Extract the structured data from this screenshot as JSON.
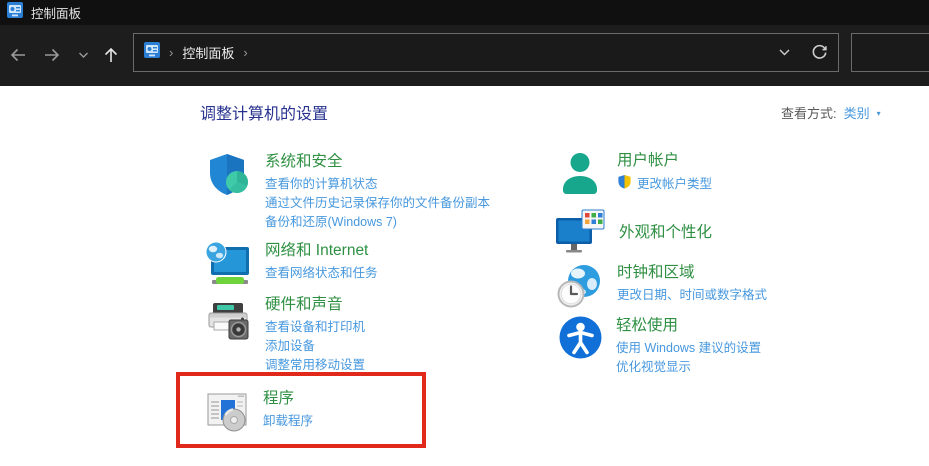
{
  "window": {
    "title": "控制面板"
  },
  "navbar": {
    "breadcrumb_root": "控制面板",
    "breadcrumb_separator": "›"
  },
  "content": {
    "heading": "调整计算机的设置",
    "view_by_label": "查看方式:",
    "view_by_value": "类别",
    "view_by_caret": "▾",
    "categories": [
      {
        "title": "系统和安全",
        "icon": "system-security-shield-icon",
        "links": [
          "查看你的计算机状态",
          "通过文件历史记录保存你的文件备份副本",
          "备份和还原(Windows 7)"
        ]
      },
      {
        "title": "网络和 Internet",
        "icon": "network-monitor-globe-icon",
        "links": [
          "查看网络状态和任务"
        ]
      },
      {
        "title": "硬件和声音",
        "icon": "printer-speaker-icon",
        "links": [
          "查看设备和打印机",
          "添加设备",
          "调整常用移动设置"
        ]
      },
      {
        "title": "程序",
        "icon": "programs-disc-icon",
        "highlighted": true,
        "links": [
          "卸载程序"
        ]
      },
      {
        "title": "用户帐户",
        "icon": "user-accounts-icon",
        "links": [
          "更改帐户类型"
        ]
      },
      {
        "title": "外观和个性化",
        "icon": "appearance-personalization-icon",
        "links": []
      },
      {
        "title": "时钟和区域",
        "icon": "clock-region-icon",
        "links": [
          "更改日期、时间或数字格式"
        ]
      },
      {
        "title": "轻松使用",
        "icon": "ease-of-access-icon",
        "links": [
          "使用 Windows 建议的设置",
          "优化视觉显示"
        ]
      }
    ]
  },
  "colors": {
    "category_title_green": "#2f9043",
    "link_blue": "#4798DE",
    "heading_navy": "#28328F",
    "highlight_red": "#E0281B",
    "titlebar_bg": "#101010",
    "navbar_bg": "#1d1d1d",
    "content_bg": "#ffffff"
  }
}
